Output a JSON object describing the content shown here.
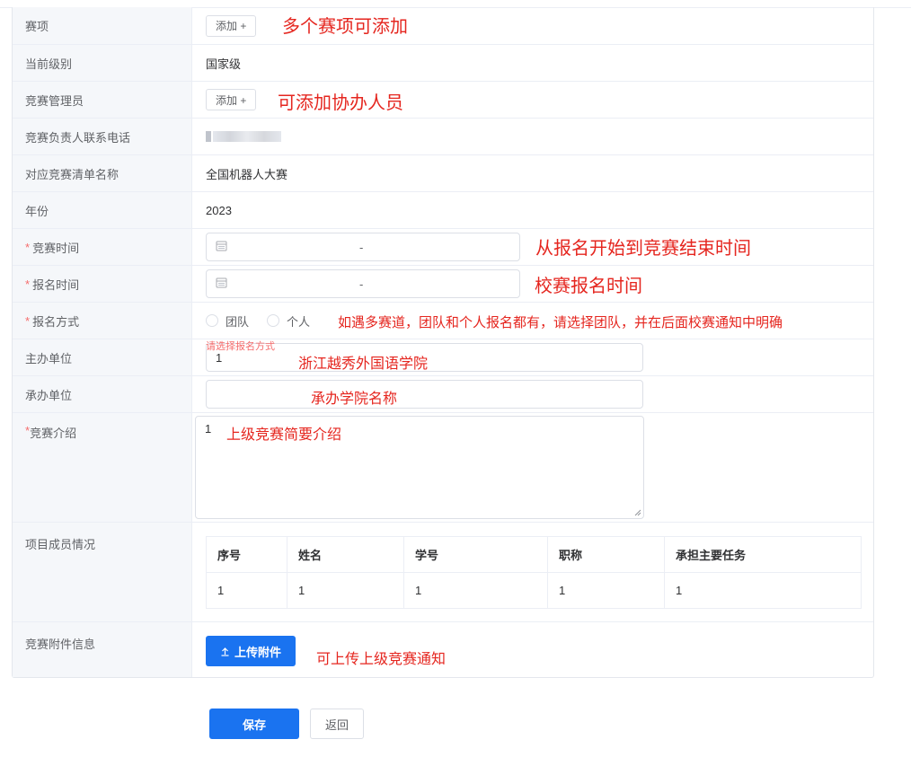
{
  "form": {
    "event_items": {
      "label": "赛项",
      "add_button": "添加 +",
      "note": "多个赛项可添加"
    },
    "level": {
      "label": "当前级别",
      "value": "国家级"
    },
    "admins": {
      "label": "竞赛管理员",
      "add_button": "添加 +",
      "note": "可添加协办人员"
    },
    "phone": {
      "label": "竞赛负责人联系电话"
    },
    "list_name": {
      "label": "对应竞赛清单名称",
      "value": "全国机器人大赛"
    },
    "year": {
      "label": "年份",
      "value": "2023"
    },
    "competition_time": {
      "required_mark": "*",
      "label": "竞赛时间",
      "separator": "-",
      "note": "从报名开始到竞赛结束时间"
    },
    "signup_time": {
      "required_mark": "*",
      "label": "报名时间",
      "separator": "-",
      "note": "校赛报名时间"
    },
    "signup_mode": {
      "required_mark": "*",
      "label": "报名方式",
      "options": [
        "团队",
        "个人"
      ],
      "note": "如遇多赛道，团队和个人报名都有，请选择团队，并在后面校赛通知中明确",
      "error": "请选择报名方式"
    },
    "organizer": {
      "label": "主办单位",
      "value": "1",
      "note": "浙江越秀外国语学院"
    },
    "undertaker": {
      "label": "承办单位",
      "value": "",
      "note": "承办学院名称"
    },
    "intro": {
      "required_mark": "*",
      "label": "竞赛介绍",
      "value": "1",
      "note": "上级竞赛简要介绍"
    },
    "members": {
      "label": "项目成员情况",
      "columns": [
        "序号",
        "姓名",
        "学号",
        "职称",
        "承担主要任务"
      ],
      "rows": [
        [
          "1",
          "1",
          "1",
          "1",
          "1"
        ]
      ]
    },
    "attachments": {
      "label": "竞赛附件信息",
      "upload_button": "上传附件",
      "note": "可上传上级竞赛通知"
    }
  },
  "actions": {
    "save": "保存",
    "back": "返回"
  },
  "colors": {
    "primary": "#1a73f0",
    "annotation": "#e5261f",
    "required": "#f56c6c",
    "label_bg": "#f5f7fa"
  }
}
